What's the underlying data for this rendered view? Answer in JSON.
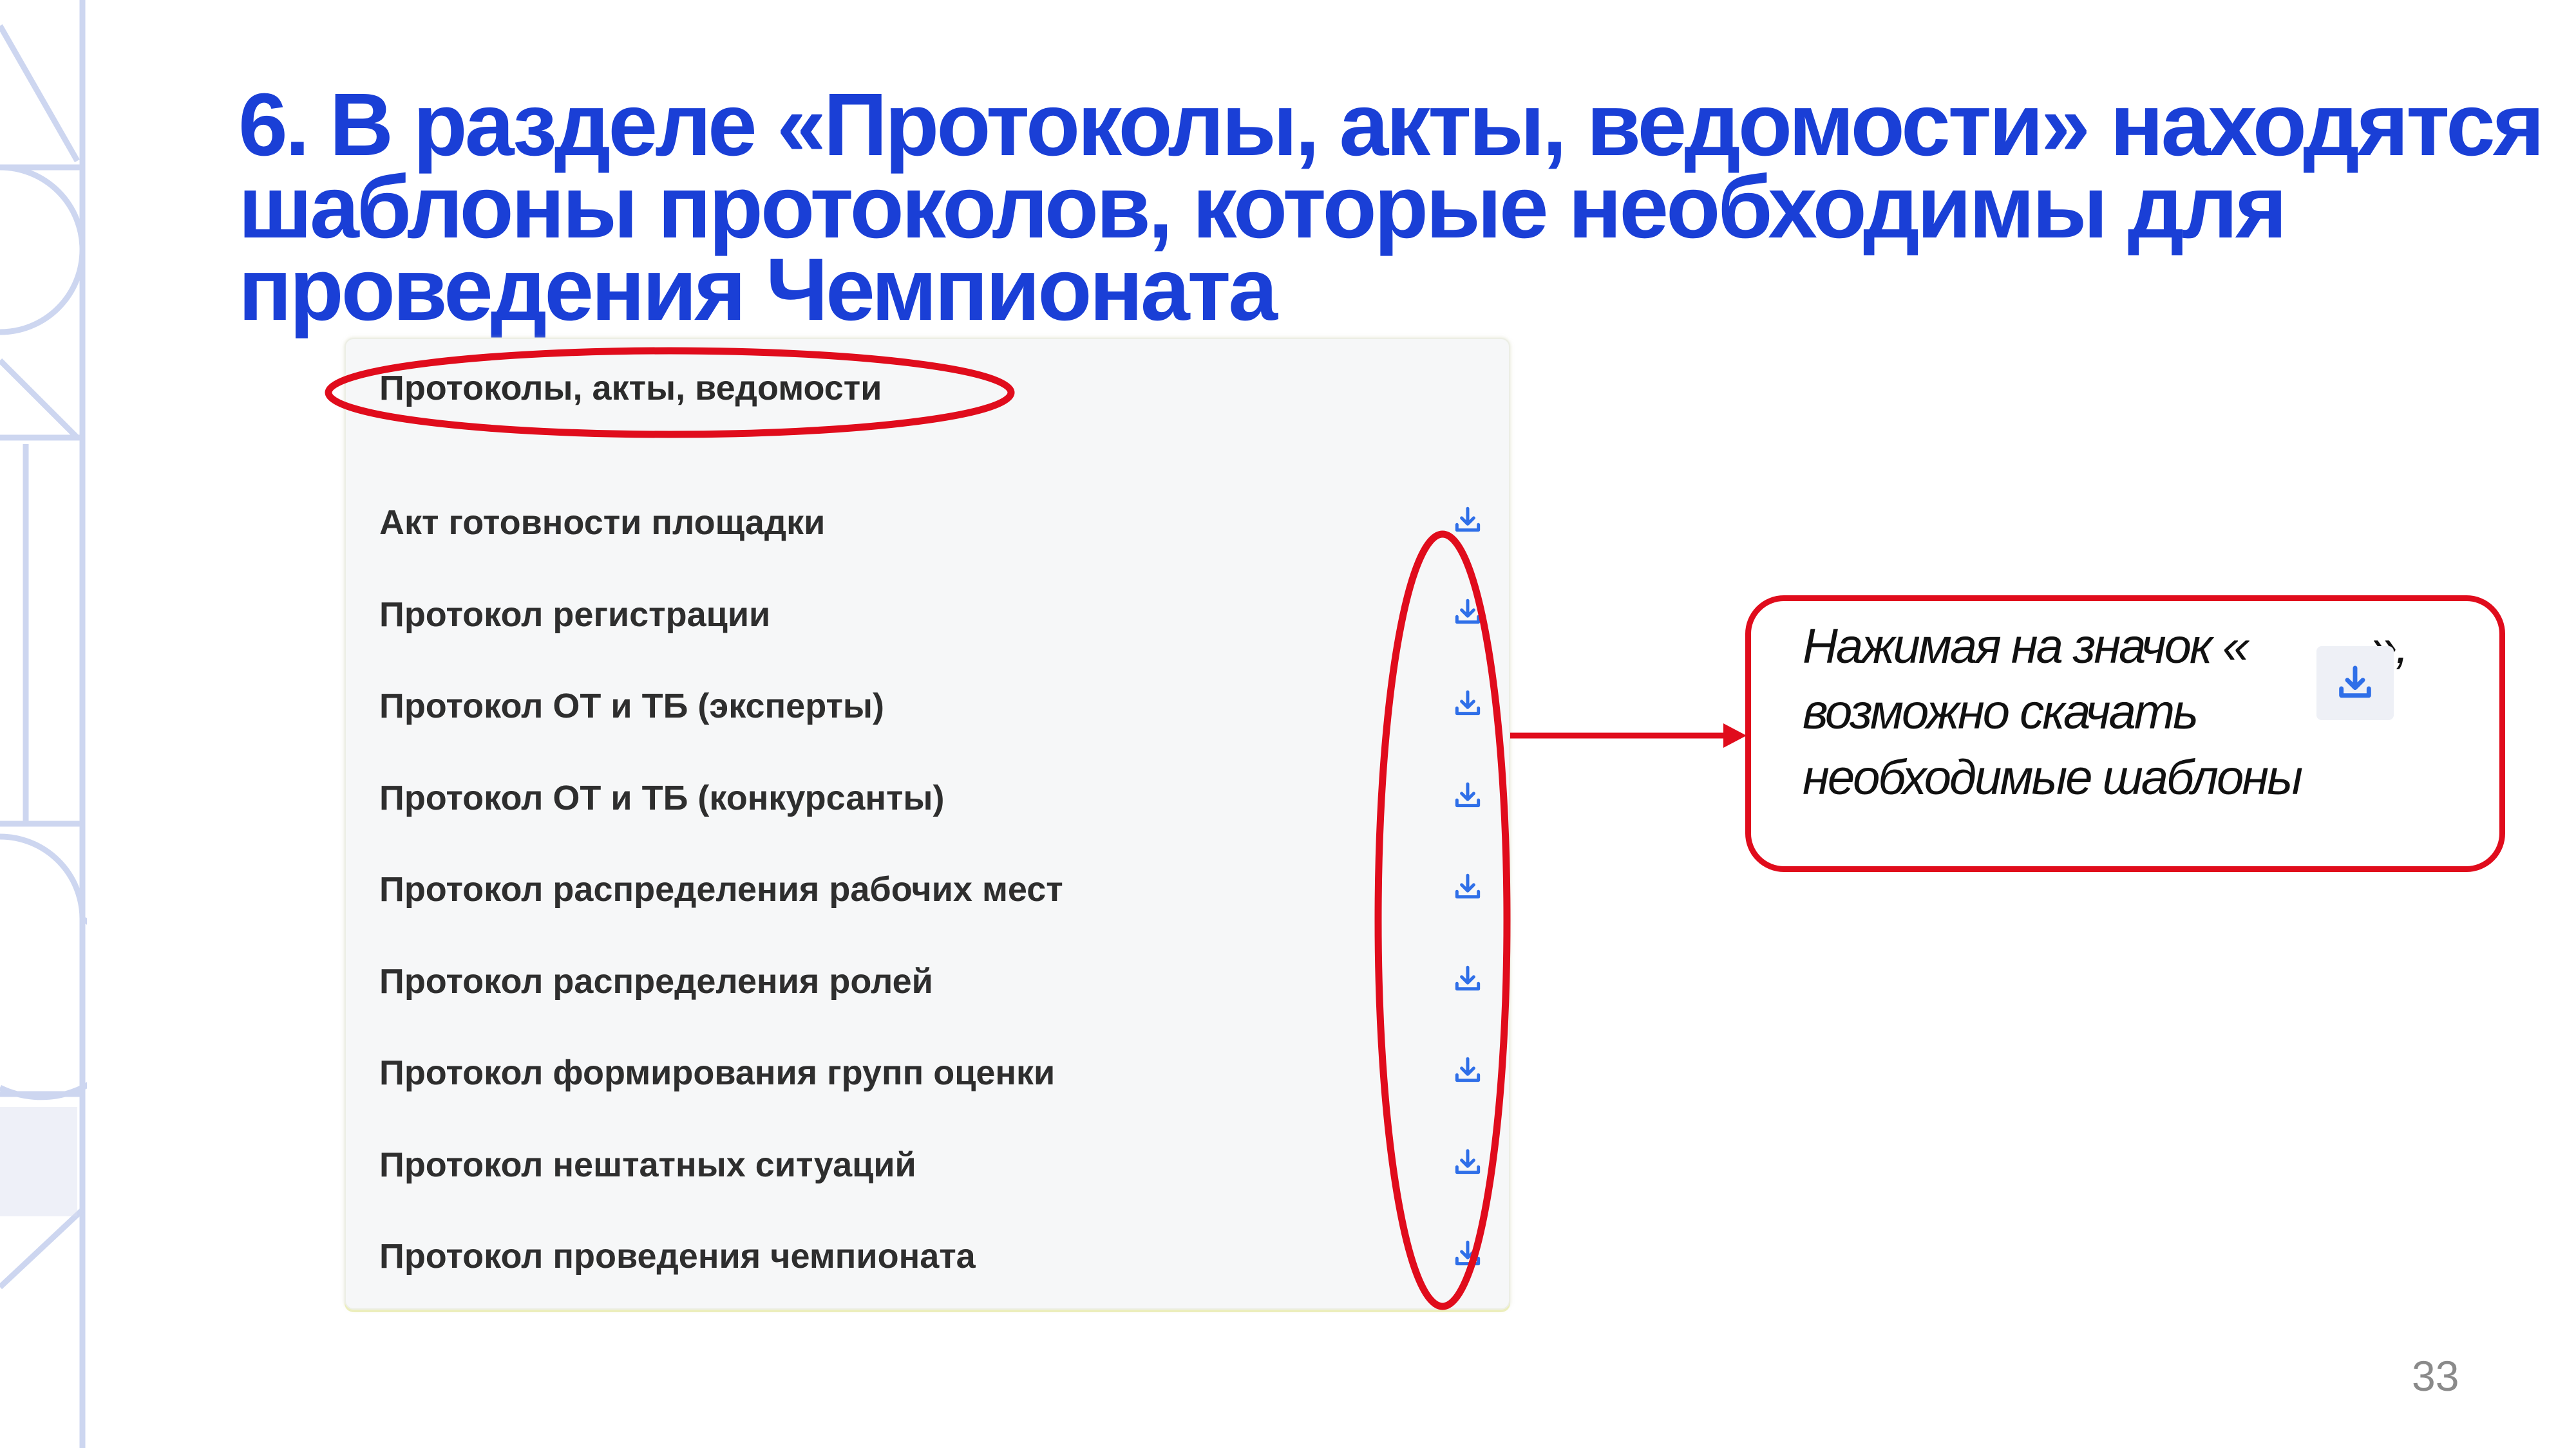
{
  "slide": {
    "title_lines": [
      "6. В разделе «Протоколы, акты, ведомости» находятся",
      "шаблоны протоколов, которые необходимы для",
      "проведения Чемпионата"
    ],
    "page_number": "33"
  },
  "panel": {
    "header": "Протоколы, акты, ведомости",
    "items": [
      {
        "label": "Акт готовности площадки",
        "icon": "download-icon"
      },
      {
        "label": "Протокол регистрации",
        "icon": "download-icon"
      },
      {
        "label": "Протокол ОТ и ТБ (эксперты)",
        "icon": "download-icon"
      },
      {
        "label": "Протокол ОТ и ТБ (конкурсанты)",
        "icon": "download-icon"
      },
      {
        "label": "Протокол распределения рабочих мест",
        "icon": "download-icon"
      },
      {
        "label": "Протокол распределения ролей",
        "icon": "download-icon"
      },
      {
        "label": "Протокол формирования групп оценки",
        "icon": "download-icon"
      },
      {
        "label": "Протокол нештатных ситуаций",
        "icon": "download-icon"
      },
      {
        "label": "Протокол проведения чемпионата",
        "icon": "download-icon"
      }
    ]
  },
  "callout": {
    "line1_before": "Нажимая на значок «",
    "line1_after": "»,",
    "line2": "возможно скачать",
    "line3": "необходимые шаблоны",
    "icon": "download-icon"
  },
  "colors": {
    "title": "#1a3fd6",
    "annotation_red": "#e00c1c",
    "icon_blue": "#2f6fe8",
    "decor": "#cdd6f0"
  }
}
